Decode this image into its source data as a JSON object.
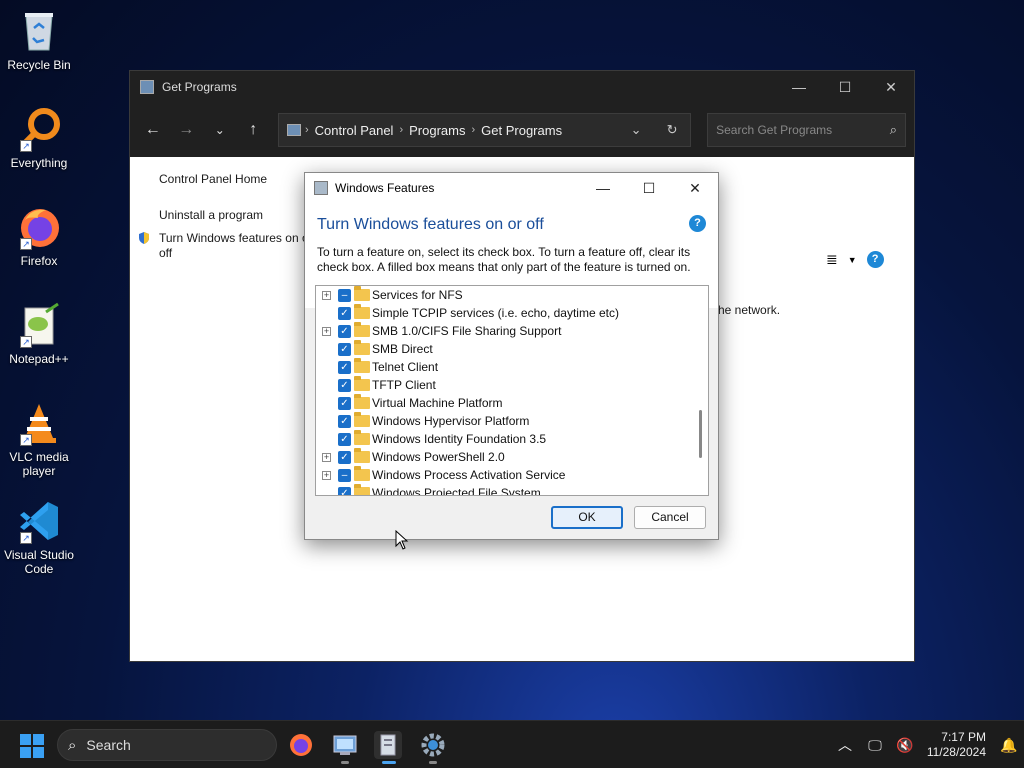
{
  "desktop": {
    "icons": [
      {
        "label": "Recycle Bin",
        "icon": "recycle-bin-icon"
      },
      {
        "label": "Everything",
        "icon": "everything-icon"
      },
      {
        "label": "Firefox",
        "icon": "firefox-icon"
      },
      {
        "label": "Notepad++",
        "icon": "notepadpp-icon"
      },
      {
        "label": "VLC media player",
        "icon": "vlc-icon"
      },
      {
        "label": "Visual Studio Code",
        "icon": "vscode-icon"
      }
    ]
  },
  "explorer": {
    "title": "Get Programs",
    "breadcrumb": [
      "Control Panel",
      "Programs",
      "Get Programs"
    ],
    "search_placeholder": "Search Get Programs",
    "left_links": {
      "home": "Control Panel Home",
      "uninstall": "Uninstall a program",
      "features_line1": "Turn Windows features on o",
      "features_line2": "off"
    },
    "right_fragment": "he network."
  },
  "dialog": {
    "title": "Windows Features",
    "heading": "Turn Windows features on or off",
    "description": "To turn a feature on, select its check box. To turn a feature off, clear its check box. A filled box means that only part of the feature is turned on.",
    "features": [
      {
        "label": "Services for NFS",
        "expandable": true,
        "state": "partial"
      },
      {
        "label": "Simple TCPIP services (i.e. echo, daytime etc)",
        "expandable": false,
        "state": "checked"
      },
      {
        "label": "SMB 1.0/CIFS File Sharing Support",
        "expandable": true,
        "state": "checked"
      },
      {
        "label": "SMB Direct",
        "expandable": false,
        "state": "checked"
      },
      {
        "label": "Telnet Client",
        "expandable": false,
        "state": "checked"
      },
      {
        "label": "TFTP Client",
        "expandable": false,
        "state": "checked"
      },
      {
        "label": "Virtual Machine Platform",
        "expandable": false,
        "state": "checked"
      },
      {
        "label": "Windows Hypervisor Platform",
        "expandable": false,
        "state": "checked"
      },
      {
        "label": "Windows Identity Foundation 3.5",
        "expandable": false,
        "state": "checked"
      },
      {
        "label": "Windows PowerShell 2.0",
        "expandable": true,
        "state": "checked"
      },
      {
        "label": "Windows Process Activation Service",
        "expandable": true,
        "state": "partial"
      },
      {
        "label": "Windows Projected File System",
        "expandable": false,
        "state": "checked"
      }
    ],
    "ok_label": "OK",
    "cancel_label": "Cancel"
  },
  "taskbar": {
    "search_label": "Search",
    "time": "7:17 PM",
    "date": "11/28/2024"
  },
  "colors": {
    "accent": "#1a6fc9",
    "heading_blue": "#1a4e9a",
    "titlebar_dark": "#202020"
  }
}
